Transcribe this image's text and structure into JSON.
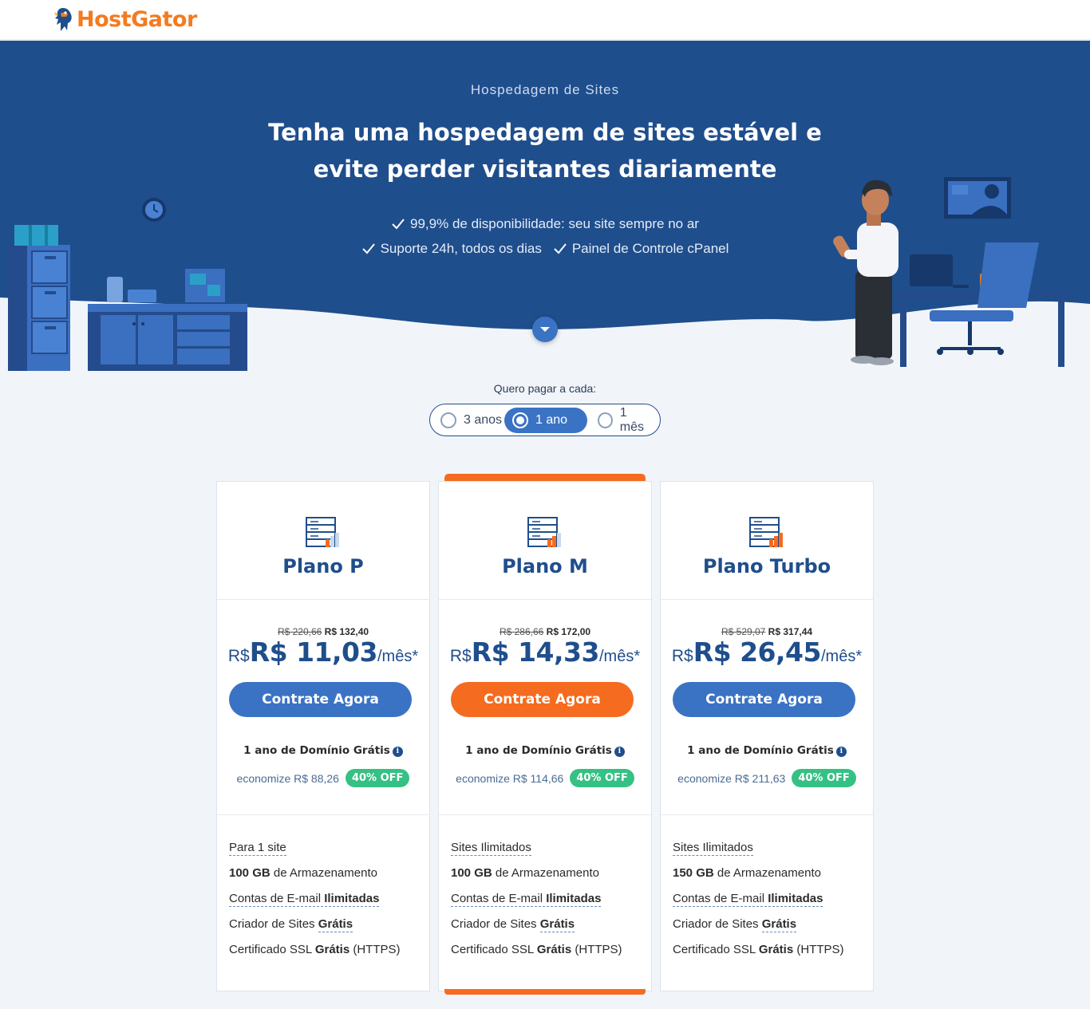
{
  "brand": {
    "name": "HostGator",
    "color": "#f47b20"
  },
  "hero": {
    "eyebrow": "Hospedagem de Sites",
    "headline_line1": "Tenha uma hospedagem de sites estável e",
    "headline_line2": "evite perder visitantes diariamente",
    "bullets": [
      "99,9% de disponibilidade: seu site sempre no ar",
      "Suporte 24h, todos os dias",
      "Painel de Controle cPanel"
    ],
    "bg_color": "#1f4e8c"
  },
  "billing": {
    "label": "Quero pagar a cada:",
    "options": [
      "3 anos",
      "1 ano",
      "1 mês"
    ],
    "selected": "1 ano"
  },
  "plans": [
    {
      "name": "Plano P",
      "old_price": "R$ 220,66",
      "new_total": "R$ 132,40",
      "currency_prefix": "R$",
      "price": "R$ 11,03",
      "per": "/mês*",
      "cta": "Contrate Agora",
      "domain": "1 ano de Domínio Grátis",
      "savings": "economize R$ 88,26",
      "discount": "40% OFF",
      "features": [
        {
          "pre": "Para 1 site",
          "bold": "",
          "post": ""
        },
        {
          "pre": "",
          "bold": "100 GB",
          "post": " de Armazenamento"
        },
        {
          "pre": "Contas de E-mail ",
          "bold": "Ilimitadas",
          "post": ""
        },
        {
          "pre": "Criador de Sites ",
          "bold": "Grátis",
          "post": ""
        },
        {
          "pre": "Certificado SSL ",
          "bold": "Grátis",
          "post": " (HTTPS)"
        }
      ]
    },
    {
      "name": "Plano M",
      "old_price": "R$ 286,66",
      "new_total": "R$ 172,00",
      "currency_prefix": "R$",
      "price": "R$ 14,33",
      "per": "/mês*",
      "cta": "Contrate Agora",
      "domain": "1 ano de Domínio Grátis",
      "savings": "economize R$ 114,66",
      "discount": "40% OFF",
      "features": [
        {
          "pre": "Sites Ilimitados",
          "bold": "",
          "post": ""
        },
        {
          "pre": "",
          "bold": "100 GB",
          "post": " de Armazenamento"
        },
        {
          "pre": "Contas de E-mail ",
          "bold": "Ilimitadas",
          "post": ""
        },
        {
          "pre": "Criador de Sites ",
          "bold": "Grátis",
          "post": ""
        },
        {
          "pre": "Certificado SSL ",
          "bold": "Grátis",
          "post": " (HTTPS)"
        }
      ]
    },
    {
      "name": "Plano Turbo",
      "old_price": "R$ 529,07",
      "new_total": "R$ 317,44",
      "currency_prefix": "R$",
      "price": "R$ 26,45",
      "per": "/mês*",
      "cta": "Contrate Agora",
      "domain": "1 ano de Domínio Grátis",
      "savings": "economize R$ 211,63",
      "discount": "40% OFF",
      "features": [
        {
          "pre": "Sites Ilimitados",
          "bold": "",
          "post": ""
        },
        {
          "pre": "",
          "bold": "150 GB",
          "post": " de Armazenamento"
        },
        {
          "pre": "Contas de E-mail ",
          "bold": "Ilimitadas",
          "post": ""
        },
        {
          "pre": "Criador de Sites ",
          "bold": "Grátis",
          "post": ""
        },
        {
          "pre": "Certificado SSL ",
          "bold": "Grátis",
          "post": " (HTTPS)"
        }
      ]
    }
  ],
  "colors": {
    "primary_blue": "#3b73c4",
    "featured_orange": "#f56b1f",
    "discount_green": "#35c184"
  }
}
